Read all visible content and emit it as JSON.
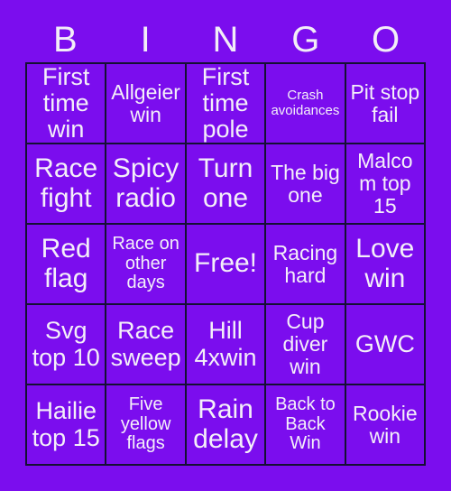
{
  "card": {
    "title": "BINGO",
    "background_color": "#7B0DEE",
    "text_color": "#F4EFF9",
    "border_color": "#151033",
    "header_letters": [
      "B",
      "I",
      "N",
      "G",
      "O"
    ],
    "rows": [
      [
        {
          "text": "First time win",
          "size": "lg"
        },
        {
          "text": "Allgeier win",
          "size": "md"
        },
        {
          "text": "First time pole",
          "size": "lg"
        },
        {
          "text": "Crash avoidances",
          "size": "xs"
        },
        {
          "text": "Pit stop fail",
          "size": "md"
        }
      ],
      [
        {
          "text": "Race fight",
          "size": "xl"
        },
        {
          "text": "Spicy radio",
          "size": "xl"
        },
        {
          "text": "Turn one",
          "size": "xl"
        },
        {
          "text": "The big one",
          "size": "md"
        },
        {
          "text": "Malcom top 15",
          "size": "md"
        }
      ],
      [
        {
          "text": "Red flag",
          "size": "xl"
        },
        {
          "text": "Race on other days",
          "size": "sm"
        },
        {
          "text": "Free!",
          "size": "xl"
        },
        {
          "text": "Racing hard",
          "size": "md"
        },
        {
          "text": "Love win",
          "size": "xl"
        }
      ],
      [
        {
          "text": "Svg top 10",
          "size": "lg"
        },
        {
          "text": "Race sweep",
          "size": "lg"
        },
        {
          "text": "Hill 4xwin",
          "size": "lg"
        },
        {
          "text": "Cup diver win",
          "size": "md"
        },
        {
          "text": "GWC",
          "size": "lg"
        }
      ],
      [
        {
          "text": "Hailie top 15",
          "size": "lg"
        },
        {
          "text": "Five yellow flags",
          "size": "sm"
        },
        {
          "text": "Rain delay",
          "size": "xl"
        },
        {
          "text": "Back to Back Win",
          "size": "sm"
        },
        {
          "text": "Rookie win",
          "size": "md"
        }
      ]
    ]
  }
}
